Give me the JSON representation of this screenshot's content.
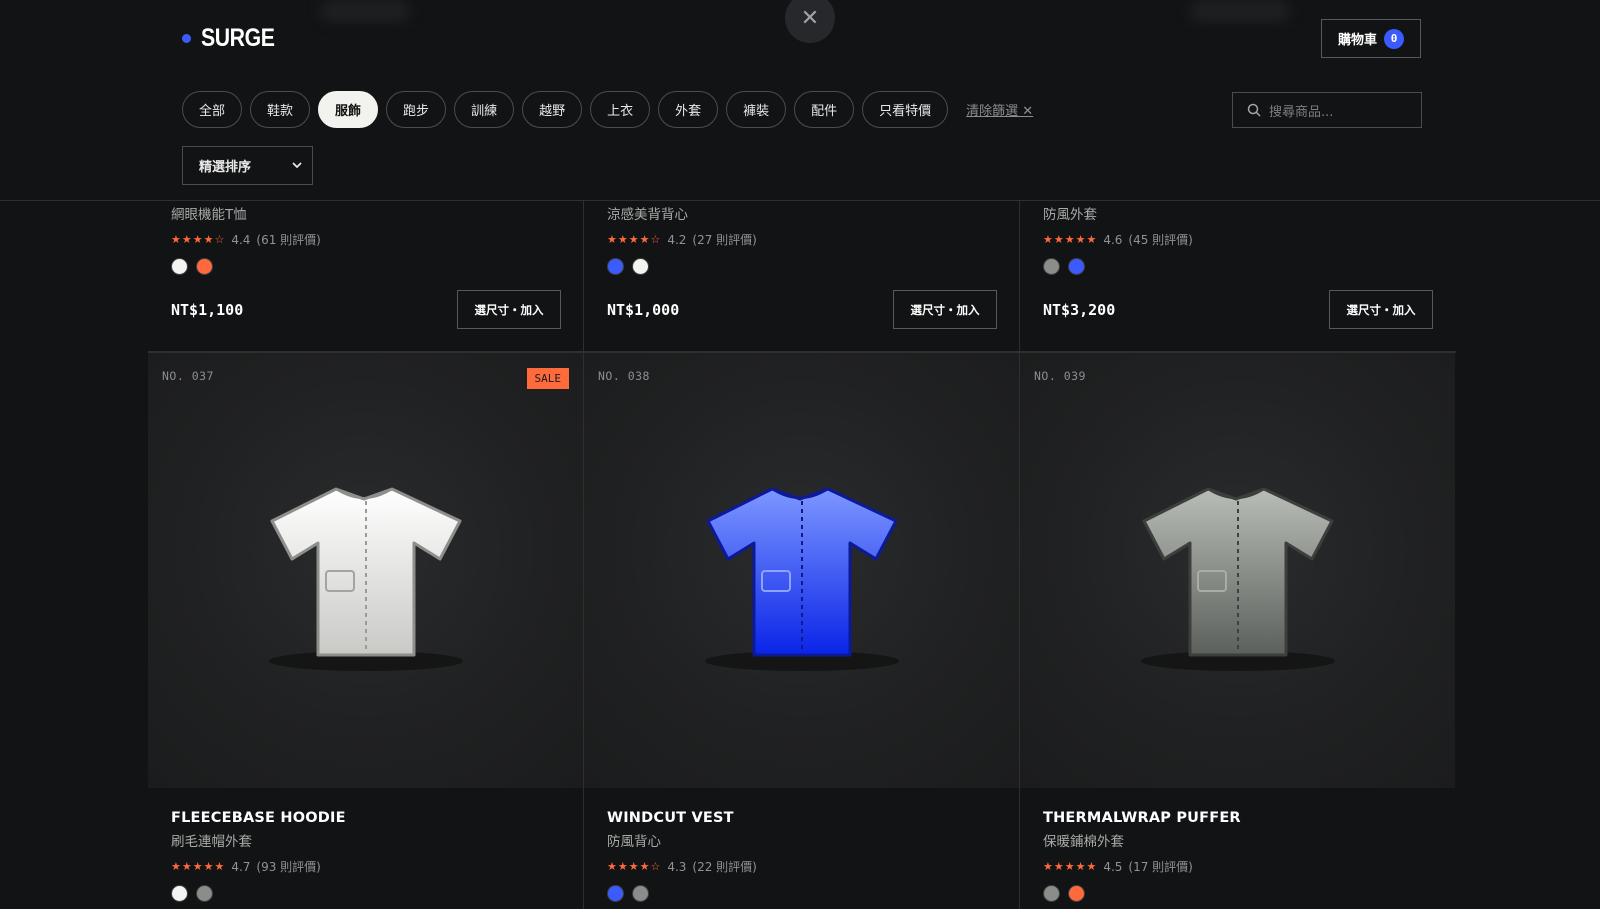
{
  "header": {
    "logo": "SURGE",
    "cart_label": "購物車",
    "cart_count": "0",
    "close_icon": "close-icon"
  },
  "filters": {
    "chips": [
      {
        "label": "全部",
        "active": false
      },
      {
        "label": "鞋款",
        "active": false
      },
      {
        "label": "服飾",
        "active": true
      },
      {
        "label": "跑步",
        "active": false
      },
      {
        "label": "訓練",
        "active": false
      },
      {
        "label": "越野",
        "active": false
      },
      {
        "label": "上衣",
        "active": false
      },
      {
        "label": "外套",
        "active": false
      },
      {
        "label": "褲裝",
        "active": false
      },
      {
        "label": "配件",
        "active": false
      },
      {
        "label": "只看特價",
        "active": false
      }
    ],
    "clear_label": "清除篩選 ✕",
    "search_placeholder": "搜尋商品...",
    "sort_selected": "精選排序"
  },
  "colors": {
    "accent_blue": "#3b5bff",
    "accent_orange": "#ff6a3d",
    "background": "#121314"
  },
  "top_row": [
    {
      "subtitle": "網眼機能T恤",
      "stars": "★★★★☆",
      "rating": "4.4",
      "reviews": "(61 則評價)",
      "swatches": [
        "#f4f4f2",
        "#ff6a3d"
      ],
      "price": "NT$1,100",
      "button": "選尺寸・加入"
    },
    {
      "subtitle": "涼感美背背心",
      "stars": "★★★★☆",
      "rating": "4.2",
      "reviews": "(27 則評價)",
      "swatches": [
        "#3b5bff",
        "#f4f4f2"
      ],
      "price": "NT$1,000",
      "button": "選尺寸・加入"
    },
    {
      "subtitle": "防風外套",
      "stars": "★★★★★",
      "rating": "4.6",
      "reviews": "(45 則評價)",
      "swatches": [
        "#8a8d8a",
        "#3b5bff"
      ],
      "price": "NT$3,200",
      "button": "選尺寸・加入"
    }
  ],
  "products": [
    {
      "no": "NO. 037",
      "sale": "SALE",
      "name": "FLEECEBASE HOODIE",
      "subtitle": "刷毛連帽外套",
      "stars": "★★★★★",
      "rating": "4.7",
      "reviews": "(93 則評價)",
      "swatches": [
        "#f4f4f2",
        "#8a8d8a"
      ]
    },
    {
      "no": "NO. 038",
      "sale": "",
      "name": "WINDCUT VEST",
      "subtitle": "防風背心",
      "stars": "★★★★☆",
      "rating": "4.3",
      "reviews": "(22 則評價)",
      "swatches": [
        "#3b5bff",
        "#8a8d8a"
      ]
    },
    {
      "no": "NO. 039",
      "sale": "",
      "name": "THERMALWRAP PUFFER",
      "subtitle": "保暖鋪棉外套",
      "stars": "★★★★★",
      "rating": "4.5",
      "reviews": "(17 則評價)",
      "swatches": [
        "#8a8d8a",
        "#ff6a3d"
      ]
    }
  ]
}
